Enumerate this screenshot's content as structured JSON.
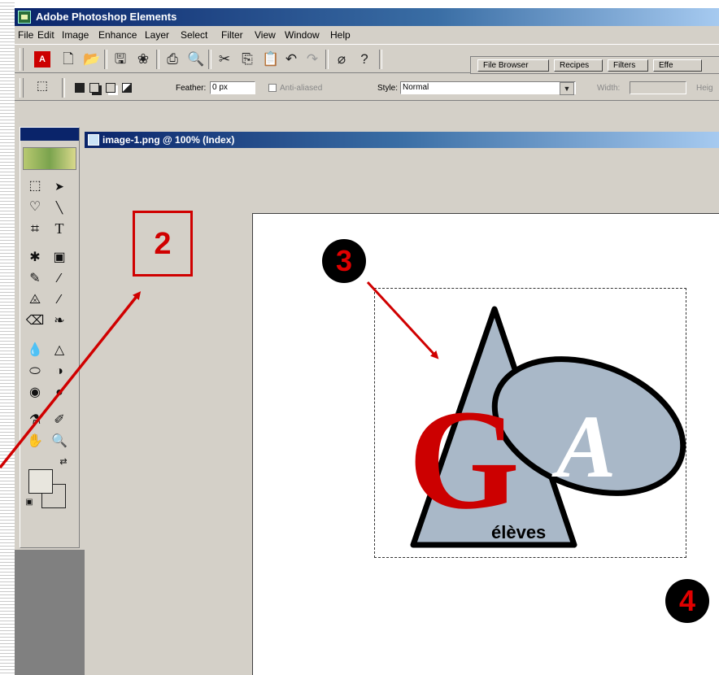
{
  "app": {
    "title": "Adobe Photoshop Elements",
    "menu": [
      "File",
      "Edit",
      "Image",
      "Enhance",
      "Layer",
      "Select",
      "Filter",
      "View",
      "Window",
      "Help"
    ]
  },
  "toolbar": {
    "palette_tabs": [
      "File Browser",
      "Recipes",
      "Filters",
      "Effe"
    ]
  },
  "options": {
    "feather_label": "Feather:",
    "feather_value": "0 px",
    "anti_aliased_label": "Anti-aliased",
    "style_label": "Style:",
    "style_value": "Normal",
    "width_label": "Width:",
    "height_label_partial": "Heig"
  },
  "document": {
    "title": "image-1.png @ 100% (Index)",
    "logo_letter_g": "G",
    "logo_letter_a": "A",
    "logo_text": "élèves"
  },
  "annotations": {
    "box_label": "2",
    "badge_3": "3",
    "badge_4": "4"
  },
  "colors": {
    "title_bar": "#0a246a",
    "annotation_red": "#d00000",
    "logo_red": "#cc0000",
    "logo_blue_gray": "#a9b8c8"
  }
}
